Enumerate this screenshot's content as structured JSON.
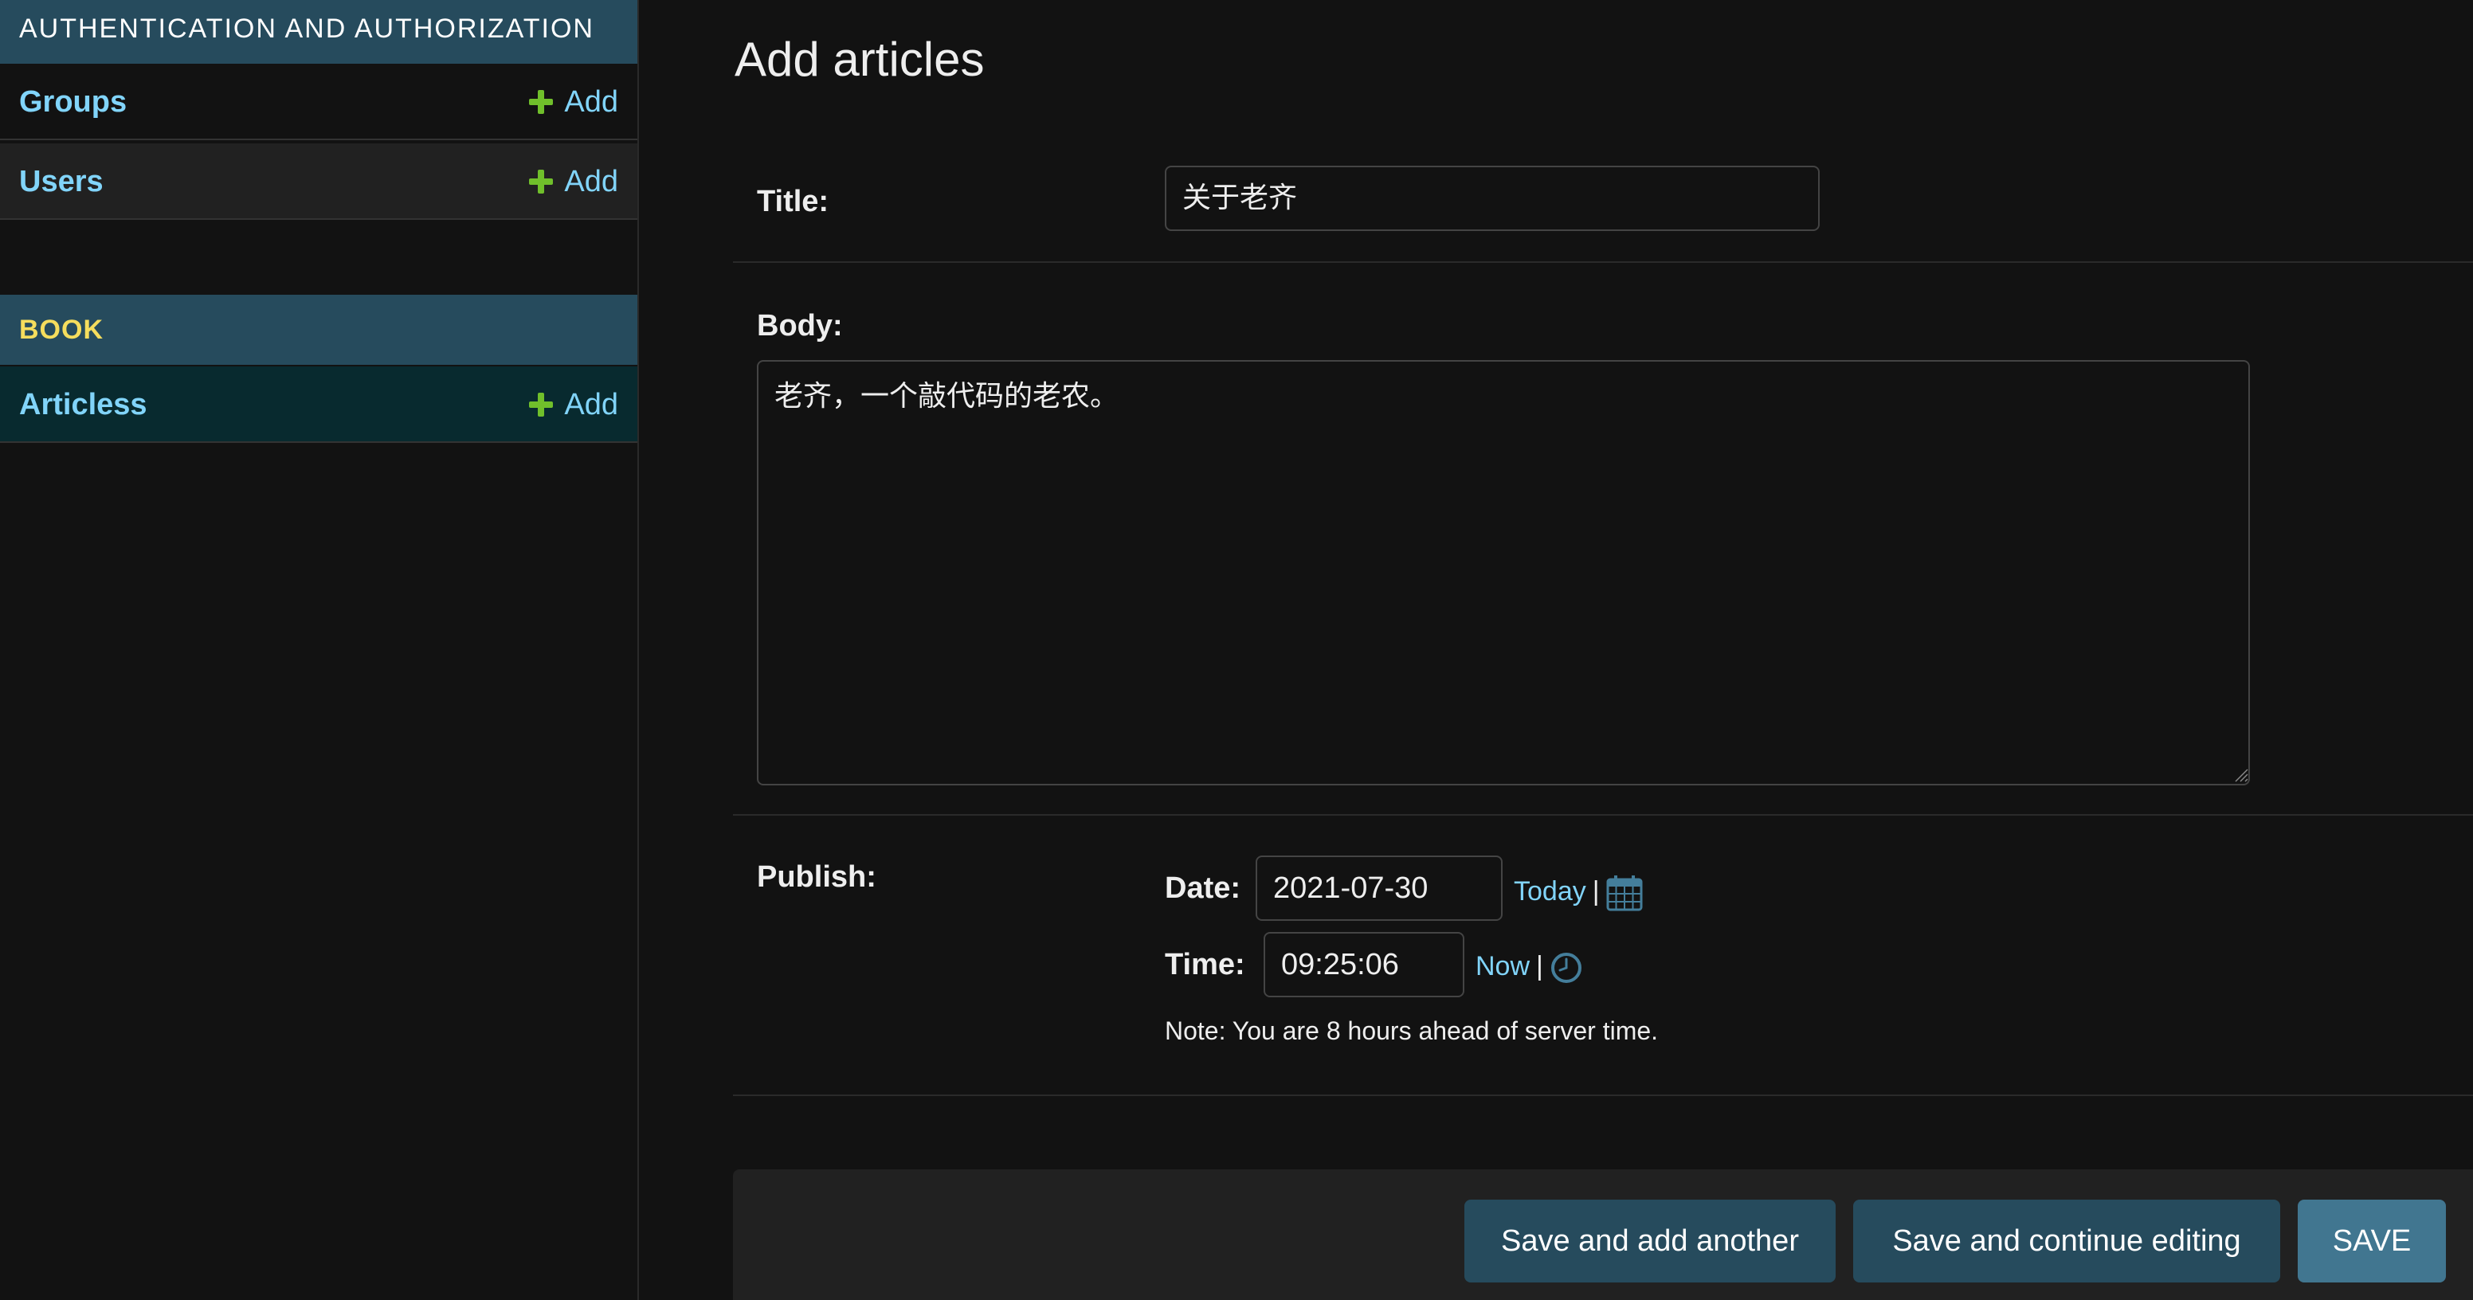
{
  "sidebar": {
    "auth_caption": "AUTHENTICATION AND AUTHORIZATION",
    "auth_items": [
      {
        "label": "Groups",
        "add_label": "Add"
      },
      {
        "label": "Users",
        "add_label": "Add"
      }
    ],
    "book_caption": "BOOK",
    "book_items": [
      {
        "label": "Articless",
        "add_label": "Add"
      }
    ]
  },
  "main": {
    "title": "Add articles",
    "fields": {
      "title": {
        "label": "Title:",
        "value": "关于老齐"
      },
      "body": {
        "label": "Body:",
        "value": "老齐，一个敲代码的老农。"
      },
      "publish": {
        "label": "Publish:",
        "date_label": "Date:",
        "date_value": "2021-07-30",
        "today_link": "Today",
        "time_label": "Time:",
        "time_value": "09:25:06",
        "now_link": "Now",
        "separator": "|",
        "note": "Note: You are 8 hours ahead of server time."
      }
    },
    "submit": {
      "save_add_another": "Save and add another",
      "save_continue": "Save and continue editing",
      "save": "SAVE"
    }
  },
  "colors": {
    "background": "#121212",
    "caption_bg": "#264b5d",
    "link": "#81d4fa",
    "add_icon": "#70bf2b",
    "book_caption_text": "#f5dd5d",
    "selected_row": "#082a2f",
    "save_button": "#417690"
  },
  "icons": {
    "add": "plus-icon",
    "calendar": "calendar-icon",
    "clock": "clock-icon"
  }
}
